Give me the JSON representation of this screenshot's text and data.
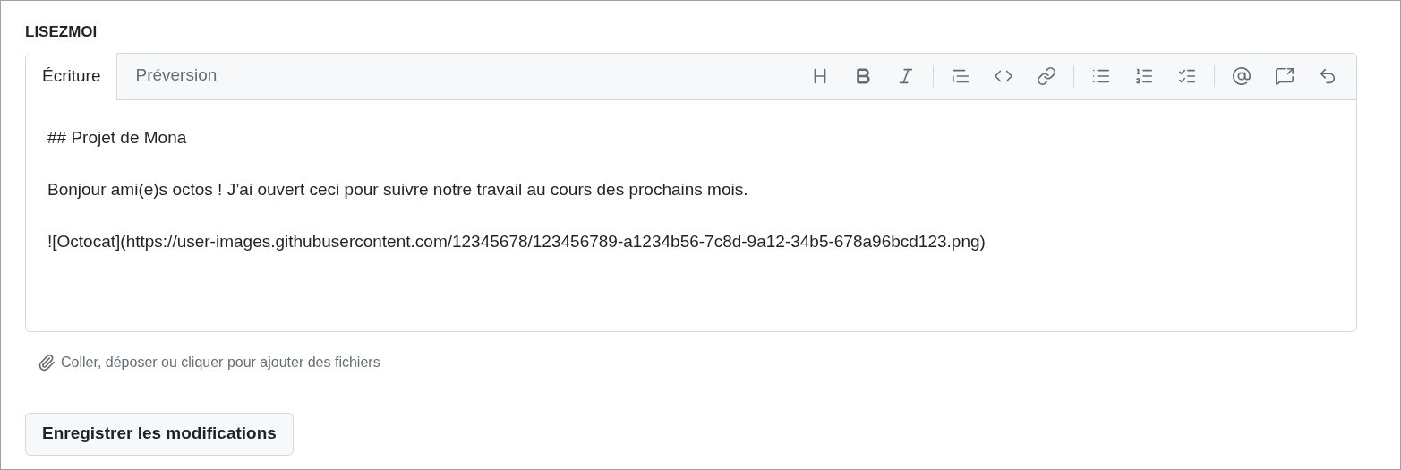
{
  "section_title": "LISEZMOI",
  "tabs": [
    {
      "label": "Écriture",
      "selected": true
    },
    {
      "label": "Préversion",
      "selected": false
    }
  ],
  "editor": {
    "paragraphs": [
      "## Projet de Mona",
      "Bonjour ami(e)s octos ! J’ai ouvert ceci pour suivre notre travail au cours des prochains mois.",
      "![Octocat](https://user-images.githubusercontent.com/12345678/123456789-a1234b56-7c8d-9a12-34b5-678a96bcd123.png)"
    ]
  },
  "attach_hint": "Coller, déposer ou cliquer pour ajouter des fichiers",
  "save_button": "Enregistrer les modifications"
}
